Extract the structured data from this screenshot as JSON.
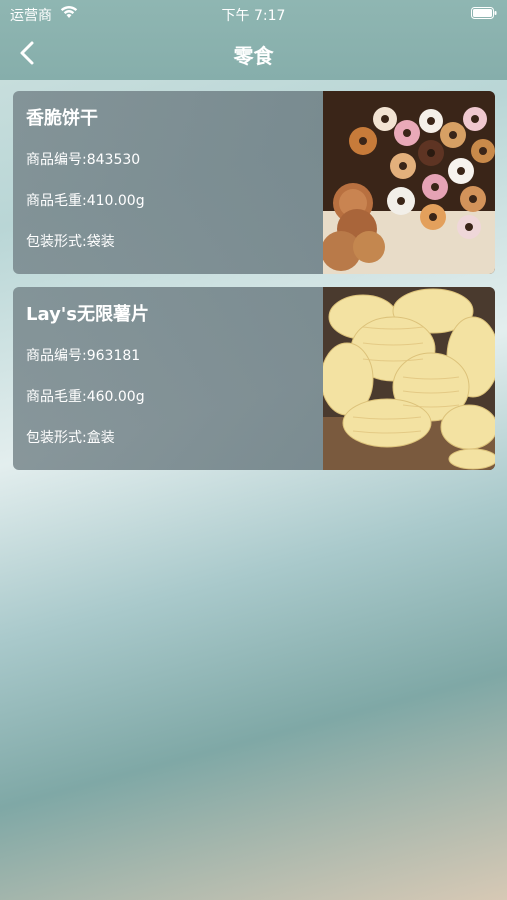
{
  "status_bar": {
    "carrier": "运营商",
    "time": "下午 7:17"
  },
  "nav": {
    "title": "零食"
  },
  "products": [
    {
      "name": "香脆饼干",
      "code": "商品编号:843530",
      "weight": "商品毛重:410.00g",
      "packaging": "包装形式:袋装",
      "image": "donuts-and-cookies"
    },
    {
      "name": "Lay's无限薯片",
      "code": "商品编号:963181",
      "weight": "商品毛重:460.00g",
      "packaging": "包装形式:盒装",
      "image": "potato-chips"
    }
  ],
  "colors": {
    "nav": "#8fb6b2",
    "card": "#74858a",
    "text": "#ffffff"
  }
}
